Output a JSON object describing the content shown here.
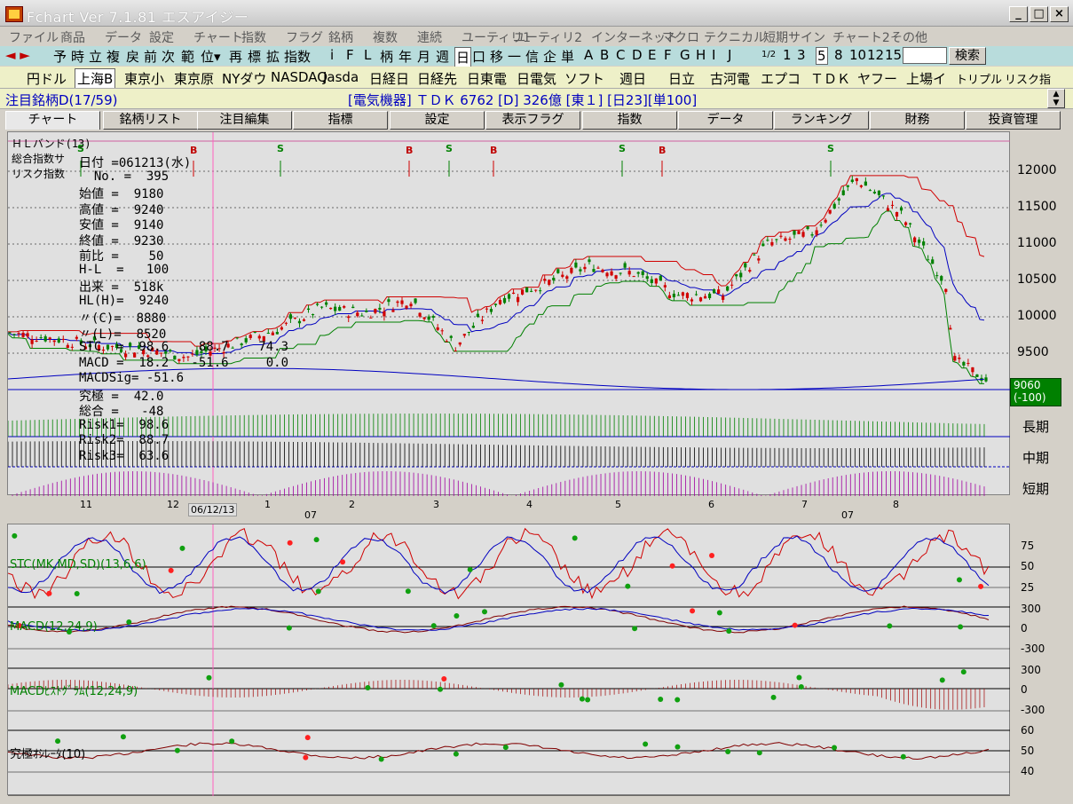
{
  "window": {
    "title": "Fchart Ver 7.1.81 エスアイジー",
    "min": "_",
    "max": "□",
    "close": "×"
  },
  "menu": [
    "ファイル",
    "商品",
    "データ",
    "設定",
    "チャート",
    "指数",
    "フラグ",
    "銘柄",
    "複数",
    "連続",
    "ユーティリ1",
    "ユーティリ2",
    "インターネット",
    "マクロ",
    "テクニカル",
    "短期サイン",
    "チャート2",
    "その他"
  ],
  "toolbar": {
    "arrows": "◄ ►",
    "items": [
      "予",
      "時",
      "立",
      "複",
      "戻",
      "前",
      "次",
      "範",
      "位▾",
      "再",
      "標",
      "拡",
      "指数",
      "i",
      "F",
      "L",
      "柄",
      "年",
      "月",
      "週",
      "日",
      "口",
      "移",
      "一",
      "信",
      "企",
      "単",
      "A",
      "B",
      "C",
      "D",
      "E",
      "F",
      "G",
      "H",
      "I",
      "J",
      "1/2",
      "1",
      "3",
      "5",
      "8",
      "10",
      "12",
      "15"
    ],
    "search_label": "検索"
  },
  "stocks": [
    "円ドル",
    "上海B",
    "東京小",
    "東京原",
    "NYダウ",
    "NASDAQ",
    "Jasda",
    "日経日",
    "日経先",
    "日東電",
    "日電気",
    "ソフト",
    "週日",
    "日立",
    "古河電",
    "エプコ",
    "ＴＤＫ",
    "ヤフー",
    "上場イ",
    "トリプル",
    "リスク指"
  ],
  "info": {
    "left": "注目銘柄D(17/59)",
    "center": "[電気機器]  ＴＤＫ  6762  [D] 326億 [東１] [日23][単100]"
  },
  "tabs": [
    "チャート",
    "銘柄リスト",
    "注目編集",
    "指標",
    "設定",
    "表示フラグ",
    "指数",
    "データ",
    "ランキング",
    "財務",
    "投資管理"
  ],
  "overlay": {
    "indicator_title": "ＨＬバンド(13)",
    "sogo": "総合指数サ",
    "risk": "リスク指数",
    "rows": [
      "日付 =061213(水)",
      "  No. =  395",
      "始値 =  9180",
      "高値 =  9240",
      "安値 =  9140",
      "終値 =  9230",
      "前比 =    50",
      "H-L  =   100",
      "出来 =  518k",
      "HL(H)=  9240",
      "〃(C)=  8880",
      "〃(L)=  8520",
      "STC  =  98.6    88.7    74.3",
      "MACD =  18.2   -51.6     0.0",
      "MACDSig= -51.6",
      "究極 =  42.0",
      "総合 =   -48",
      "Risk1=  98.6",
      "Risk2=  88.7",
      "Risk3=  63.6"
    ]
  },
  "price_axis": [
    "12000",
    "11500",
    "11000",
    "10500",
    "10000",
    "9500"
  ],
  "current_price": "9060",
  "current_change": "(-100)",
  "term_labels": [
    "長期",
    "中期",
    "短期"
  ],
  "date_labels": {
    "months": [
      "11",
      "12",
      "1",
      "2",
      "3",
      "4",
      "5",
      "6",
      "7",
      "8"
    ],
    "year1": "07",
    "year2": "07",
    "cursor": "06/12/13"
  },
  "signals": {
    "b": "B",
    "s": "S"
  },
  "lower_panels": {
    "stc": {
      "label": "STC(MK,MD,SD)(13,6,6)",
      "ticks": [
        "75",
        "50",
        "25"
      ]
    },
    "macd": {
      "label": "MACD(12,24,9)",
      "ticks": [
        "300",
        "0",
        "-300"
      ]
    },
    "macdhist": {
      "label": "MACDﾋｽﾄｸﾞﾗﾑ(12,24,9)",
      "ticks": [
        "300",
        "0",
        "-300"
      ]
    },
    "ultimate": {
      "label": "究極ｵｼﾚｰﾀ(10)",
      "ticks": [
        "60",
        "50",
        "40"
      ]
    }
  },
  "colors": {
    "up": "#d00000",
    "down": "#008000",
    "blue": "#0000c0",
    "green": "#008000",
    "red": "#d00000",
    "purple": "#a000a0",
    "bg": "#e0e0e0",
    "toolbar": "#b8dcdc",
    "info": "#eef0c8"
  }
}
